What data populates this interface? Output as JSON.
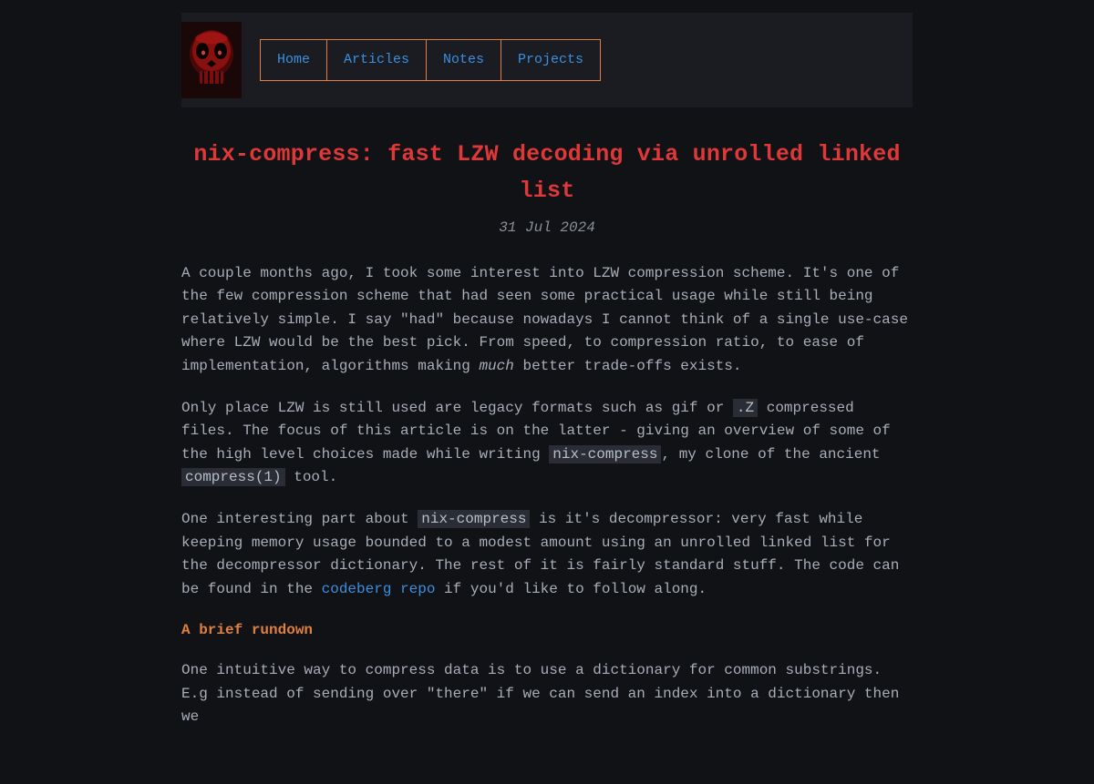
{
  "nav": {
    "items": [
      {
        "label": "Home"
      },
      {
        "label": "Articles"
      },
      {
        "label": "Notes"
      },
      {
        "label": "Projects"
      }
    ]
  },
  "article": {
    "title": "nix-compress: fast LZW decoding via unrolled linked list",
    "date": "31 Jul 2024",
    "p1a": "A couple months ago, I took some interest into LZW compression scheme. It's one of the few compression scheme that had seen some practical usage while still being relatively simple. I say \"had\" because nowadays I cannot think of a single use-case where LZW would be the best pick. From speed, to compression ratio, to ease of implementation, algorithms making ",
    "p1_em": "much",
    "p1b": " better trade-offs exists.",
    "p2a": "Only place LZW is still used are legacy formats such as gif or ",
    "p2_code1": ".Z",
    "p2b": " compressed files. The focus of this article is on the latter - giving an overview of some of the high level choices made while writing ",
    "p2_code2": "nix-compress",
    "p2c": ", my clone of the ancient ",
    "p2_code3": "compress(1)",
    "p2d": " tool.",
    "p3a": "One interesting part about ",
    "p3_code1": "nix-compress",
    "p3b": " is it's decompressor: very fast while keeping memory usage bounded to a modest amount using an unrolled linked list for the decompressor dictionary. The rest of it is fairly standard stuff. The code can be found in the ",
    "p3_link": "codeberg repo",
    "p3c": " if you'd like to follow along.",
    "section1": "A brief rundown",
    "p4": "One intuitive way to compress data is to use a dictionary for common substrings. E.g instead of sending over \"there\" if we can send an index into a dictionary then we"
  }
}
